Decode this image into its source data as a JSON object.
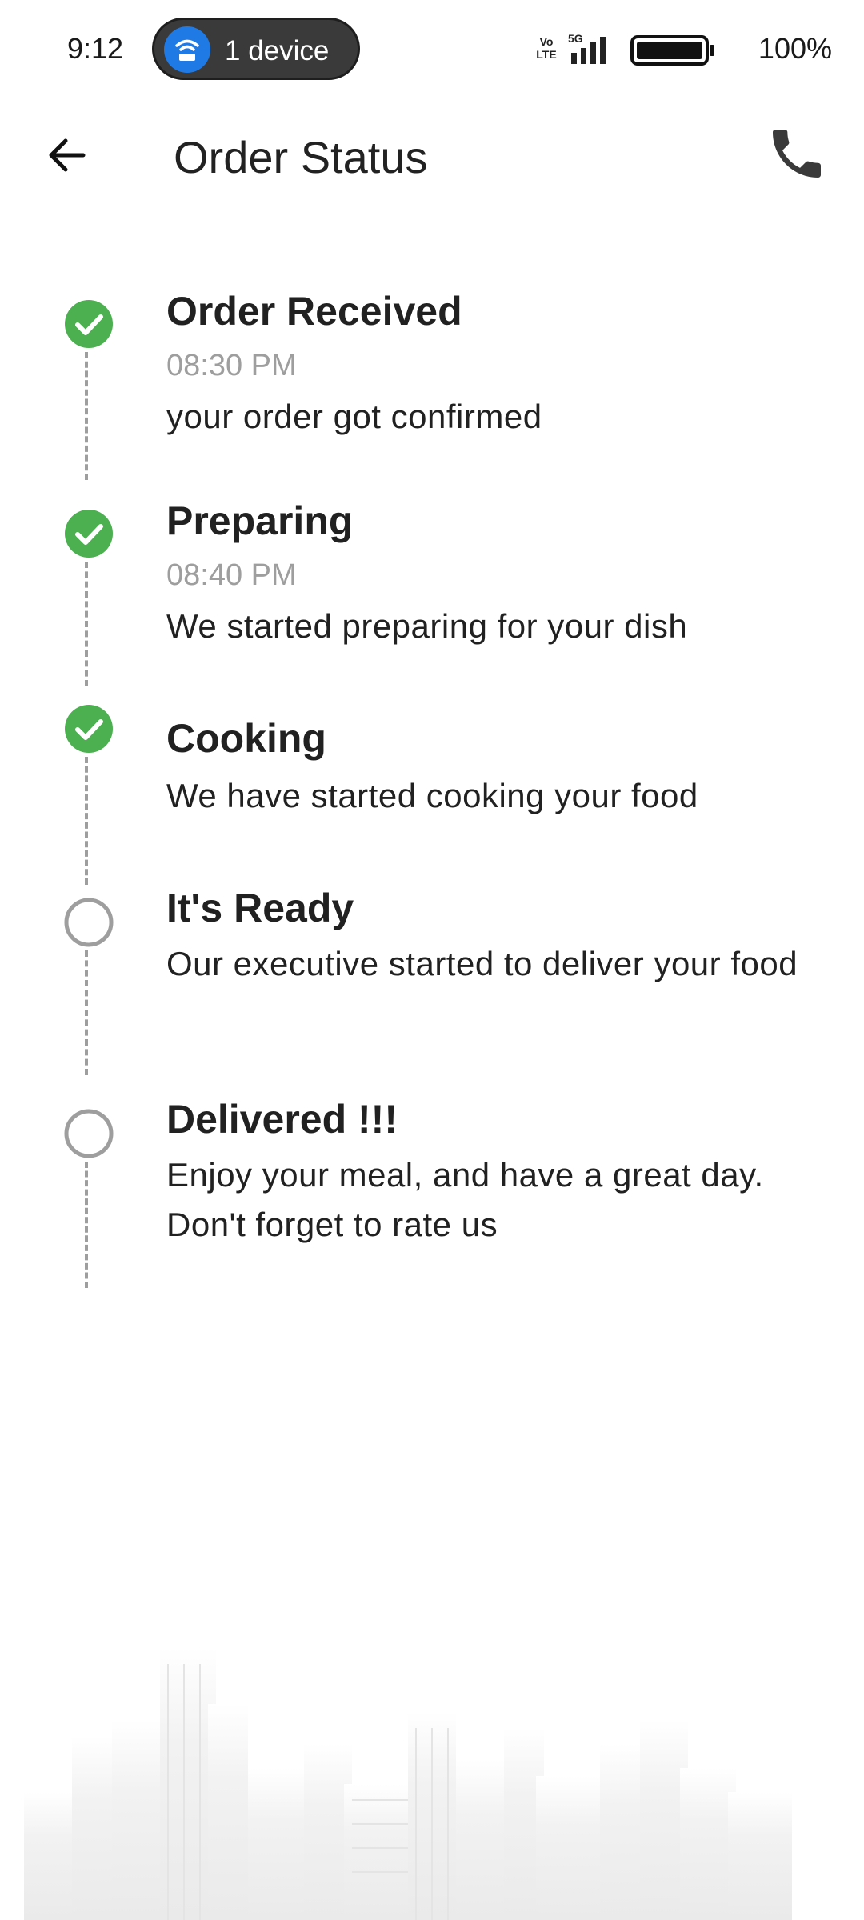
{
  "status_bar": {
    "time": "9:12",
    "hotspot_label": "1 device",
    "network_label": "5G",
    "volte_label": "Vo LTE",
    "battery_percent": "100%",
    "icons": [
      "wifi-hotspot-icon",
      "volte-icon",
      "signal-icon",
      "battery-icon"
    ]
  },
  "app_bar": {
    "title": "Order Status",
    "back_icon": "arrow-back-icon",
    "call_icon": "phone-icon"
  },
  "steps": [
    {
      "title": "Order Received",
      "time": "08:30 PM",
      "description": "your order got confirmed",
      "completed": true
    },
    {
      "title": "Preparing",
      "time": "08:40 PM",
      "description": "We started preparing for your dish",
      "completed": true
    },
    {
      "title": "Cooking",
      "time": "",
      "description": "We have started cooking your food",
      "completed": true
    },
    {
      "title": "It's Ready",
      "time": "",
      "description": "Our executive started to deliver your food",
      "completed": false
    },
    {
      "title": "Delivered !!!",
      "time": "",
      "description": "Enjoy your meal, and have a great day. Don't forget to rate us",
      "completed": false
    }
  ],
  "colors": {
    "completed": "#4caf50",
    "pending": "#9e9e9e",
    "hotspot_accent": "#1f7ae6"
  }
}
